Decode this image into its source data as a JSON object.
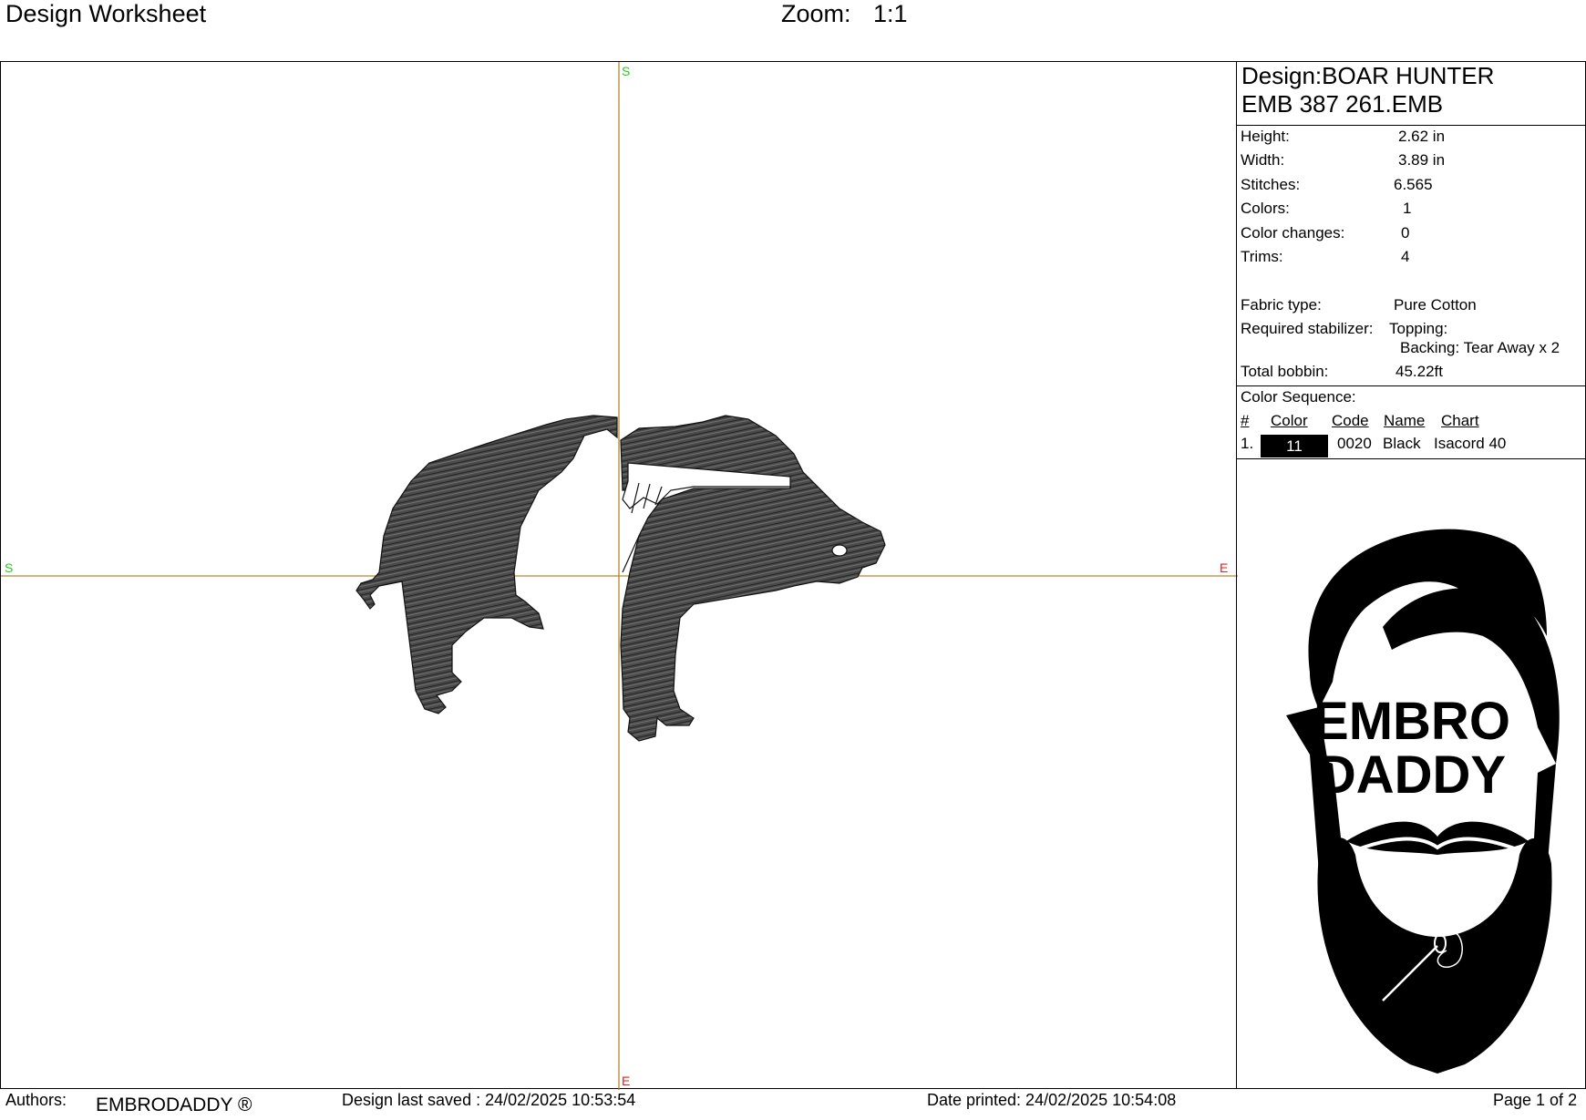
{
  "header": {
    "title": "Design Worksheet",
    "zoom_label": "Zoom:",
    "zoom_value": "1:1"
  },
  "canvas": {
    "axis_labels": {
      "top": "S",
      "left": "S",
      "right": "E",
      "bottom": "E"
    },
    "colors": {
      "axis_line": "#b8862e",
      "s_label": "#22cc22",
      "e_label": "#dd2222",
      "stitch_fill": "#444444"
    }
  },
  "info": {
    "design_label": "Design:BOAR HUNTER",
    "file_name": "EMB 387 261.EMB",
    "height_label": "Height:",
    "height_value": "2.62 in",
    "width_label": "Width:",
    "width_value": "3.89 in",
    "stitches_label": "Stitches:",
    "stitches_value": "6.565",
    "colors_label": "Colors:",
    "colors_value": "1",
    "color_changes_label": "Color changes:",
    "color_changes_value": "0",
    "trims_label": "Trims:",
    "trims_value": "4",
    "fabric_label": "Fabric type:",
    "fabric_value": "Pure Cotton",
    "stabilizer_label": "Required stabilizer:",
    "stabilizer_topping": "Topping:",
    "stabilizer_backing": "Backing: Tear Away x 2",
    "bobbin_label": "Total bobbin:",
    "bobbin_value": "45.22ft"
  },
  "color_sequence": {
    "title": "Color Sequence:",
    "headers": [
      "#",
      "Color",
      "Code",
      "Name",
      "Chart"
    ],
    "rows": [
      {
        "num": "1.",
        "color": "11",
        "code": "0020",
        "name": "Black",
        "chart": "Isacord 40",
        "swatch": "#000000"
      }
    ]
  },
  "logo": {
    "line1": "EMBRO",
    "line2": "DADDY"
  },
  "footer": {
    "authors_label": "Authors:",
    "authors_value": "EMBRODADDY ®",
    "saved": "Design last saved : 24/02/2025 10:53:54",
    "printed": "Date printed: 24/02/2025 10:54:08",
    "page": "Page 1 of 2"
  }
}
